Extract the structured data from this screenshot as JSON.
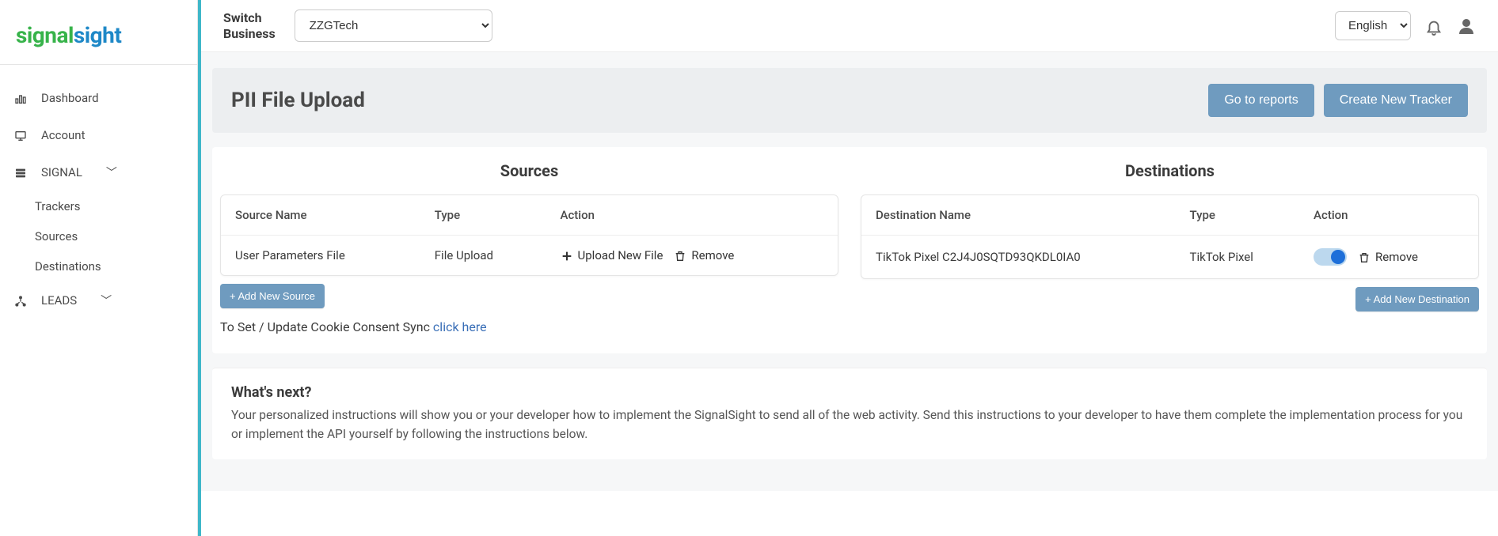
{
  "brand": {
    "part1": "signal",
    "part2": "sight"
  },
  "sidebar": {
    "items": [
      {
        "label": "Dashboard"
      },
      {
        "label": "Account"
      },
      {
        "label": "SIGNAL"
      },
      {
        "label": "LEADS"
      }
    ],
    "signal_sub": [
      {
        "label": "Trackers"
      },
      {
        "label": "Sources"
      },
      {
        "label": "Destinations"
      }
    ]
  },
  "topbar": {
    "switch_label_line1": "Switch",
    "switch_label_line2": "Business",
    "business_selected": "ZZGTech",
    "language_selected": "English"
  },
  "page": {
    "title": "PII File Upload",
    "go_to_reports": "Go to reports",
    "create_tracker": "Create New Tracker"
  },
  "sources": {
    "title": "Sources",
    "headers": {
      "name": "Source Name",
      "type": "Type",
      "action": "Action"
    },
    "rows": [
      {
        "name": "User Parameters File",
        "type": "File Upload",
        "upload_label": "Upload New File",
        "remove_label": "Remove"
      }
    ],
    "add_button": "+ Add New Source"
  },
  "destinations": {
    "title": "Destinations",
    "headers": {
      "name": "Destination Name",
      "type": "Type",
      "action": "Action"
    },
    "rows": [
      {
        "name": "TikTok Pixel C2J4J0SQTD93QKDL0IA0",
        "type": "TikTok Pixel",
        "remove_label": "Remove"
      }
    ],
    "add_button": "+ Add New Destination"
  },
  "consent": {
    "text": "To Set / Update Cookie Consent Sync ",
    "link": "click here"
  },
  "next": {
    "heading": "What's next?",
    "body": "Your personalized instructions will show you or your developer how to implement the SignalSight to send all of the web activity. Send this instructions to your developer to have them complete the implementation process for you or implement the API yourself by following the instructions below."
  }
}
